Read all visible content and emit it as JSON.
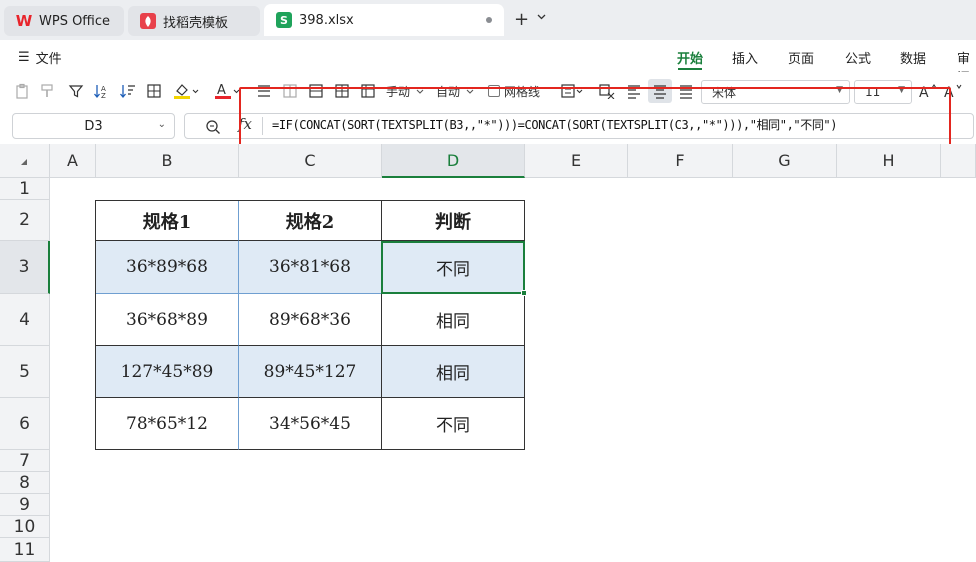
{
  "tabs": [
    {
      "label": "WPS Office",
      "icon": "wps-logo-icon"
    },
    {
      "label": "找稻壳模板",
      "icon": "docer-logo-icon"
    },
    {
      "label": "398.xlsx",
      "icon": "spreadsheet-s-icon",
      "active": true
    }
  ],
  "tabbar": {
    "add": "+",
    "more": "⌄"
  },
  "menu": {
    "file": "文件"
  },
  "ribbon_tabs": [
    "开始",
    "插入",
    "页面",
    "公式",
    "数据",
    "审阅"
  ],
  "ribbon_active": "开始",
  "toolbar": {
    "manual_label": "手动",
    "auto_label": "自动",
    "gridlines_label": "网格线",
    "font_name": "宋体",
    "font_size": "11"
  },
  "formula_bar": {
    "cell_ref": "D3",
    "fx": "fx",
    "formula": "=IF(CONCAT(SORT(TEXTSPLIT(B3,,\"*\")))=CONCAT(SORT(TEXTSPLIT(C3,,\"*\"))),\"相同\",\"不同\")"
  },
  "columns": [
    "A",
    "B",
    "C",
    "D",
    "E",
    "F",
    "G",
    "H"
  ],
  "selected_column": "D",
  "rows": [
    "1",
    "2",
    "3",
    "4",
    "5",
    "6",
    "7",
    "8",
    "9",
    "10",
    "11"
  ],
  "selected_row": "3",
  "table": {
    "headers": [
      "规格1",
      "规格2",
      "判断"
    ],
    "rows": [
      [
        "36*89*68",
        "36*81*68",
        "不同"
      ],
      [
        "36*68*89",
        "89*68*36",
        "相同"
      ],
      [
        "127*45*89",
        "89*45*127",
        "相同"
      ],
      [
        "78*65*12",
        "34*56*45",
        "不同"
      ]
    ]
  },
  "colors": {
    "accent_green": "#1a7f3c",
    "highlight_red": "#e3261f",
    "band_blue": "#dfeaf5",
    "font_color_red": "#e8242b",
    "fill_color_yellow": "#f2d400"
  }
}
